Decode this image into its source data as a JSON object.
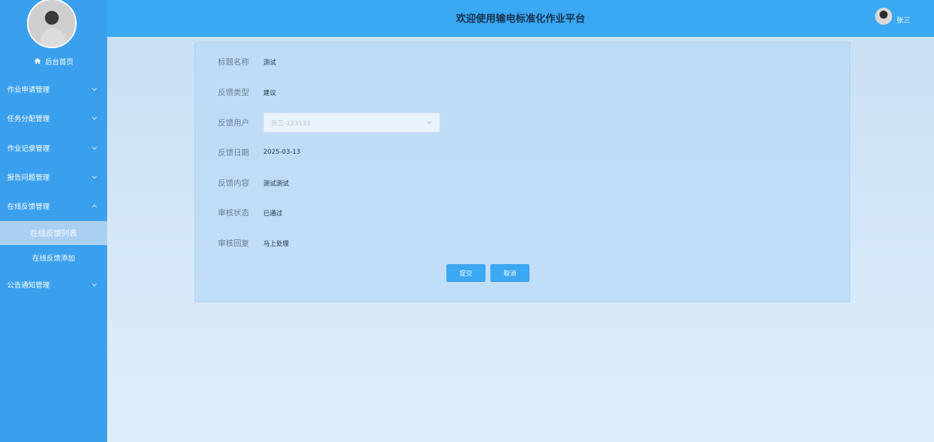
{
  "header": {
    "title": "欢迎使用输电标准化作业平台",
    "user_name": "张三"
  },
  "sidebar": {
    "home_label": "后台首页",
    "menus": [
      {
        "label": "作业申请管理",
        "expanded": false
      },
      {
        "label": "任务分配管理",
        "expanded": false
      },
      {
        "label": "作业记录管理",
        "expanded": false
      },
      {
        "label": "报告问题管理",
        "expanded": false
      },
      {
        "label": "在线反馈管理",
        "expanded": true
      },
      {
        "label": "公告通知管理",
        "expanded": false
      }
    ],
    "submenu": [
      {
        "label": "在线反馈列表",
        "active": true
      },
      {
        "label": "在线反馈添加",
        "active": false
      }
    ]
  },
  "form": {
    "title_label": "标题名称",
    "title_value": "测试",
    "type_label": "反馈类型",
    "type_value": "建议",
    "user_label": "反馈用户",
    "user_value": "张三-123123",
    "date_label": "反馈日期",
    "date_value": "2025-03-13",
    "content_label": "反馈内容",
    "content_value": "测试测试",
    "status_label": "审核状态",
    "status_value": "已通过",
    "reply_label": "审核回复",
    "reply_value": "马上处理",
    "submit_label": "提交",
    "cancel_label": "取消"
  },
  "colors": {
    "sidebar": "#3aa0ee",
    "header": "#3aa8f2",
    "primary_button": "#3aa8f2"
  }
}
